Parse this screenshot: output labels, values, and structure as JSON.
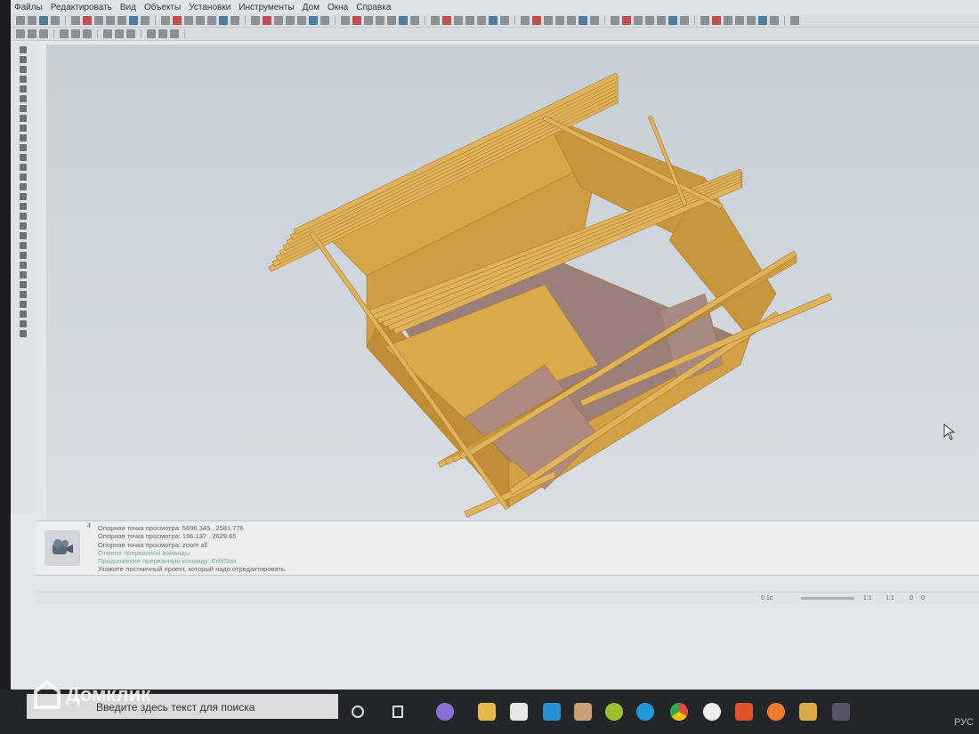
{
  "menu": [
    "Файлы",
    "Редактировать",
    "Вид",
    "Объекты",
    "Установки",
    "Инструменты",
    "Дом",
    "Окна",
    "Справка"
  ],
  "console": {
    "line_number": "4",
    "lines": [
      "Опорная точка просмотра: 5696.345 , 2581.776",
      "Опорная точка просмотра: 196.137 , 2629.65",
      "Опорная точка просмотра: zoom all",
      "Отмена прерванной команды",
      "Продолжение прерванную команду: EditStair",
      "Укажите лестничный проект, который надо отредактировать."
    ]
  },
  "status": {
    "time": "0.1с",
    "scale1": "1:1",
    "scale2": "1:1",
    "v1": "0",
    "v2": "0"
  },
  "taskbar": {
    "search_placeholder": "Введите здесь текст для поиска",
    "language": "РУС"
  },
  "watermark": "Домклик",
  "colors": {
    "wood": "#d9a94a",
    "brick": "#8a6f72",
    "viewport": "#c9d1d9"
  }
}
